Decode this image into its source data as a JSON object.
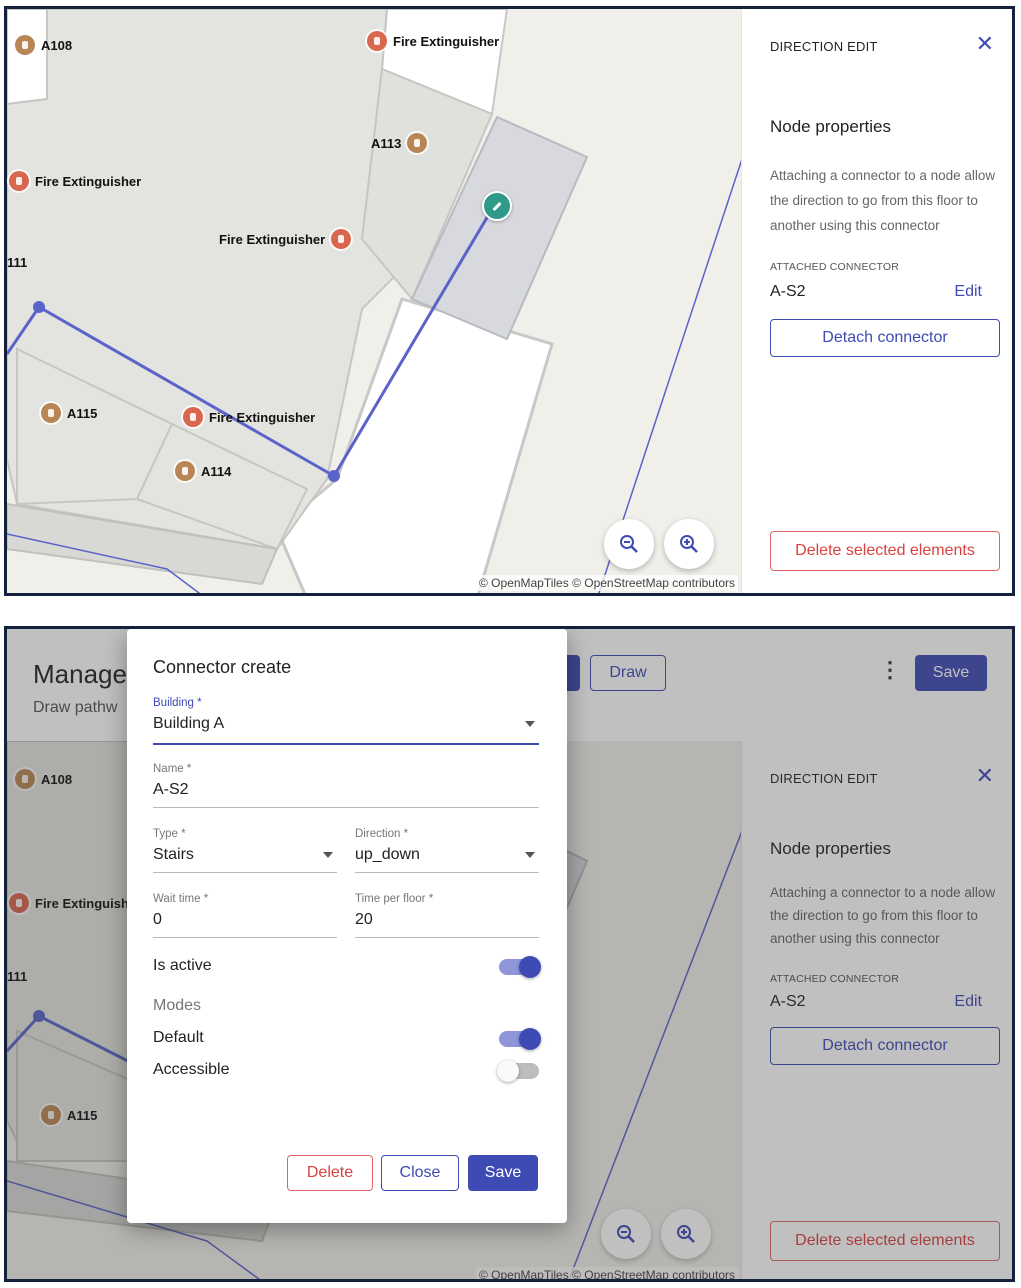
{
  "top_view": {
    "map": {
      "pois": [
        {
          "label": "A108",
          "kind": "room"
        },
        {
          "label": "Fire Extinguisher",
          "kind": "extinguisher"
        },
        {
          "label": "A113",
          "kind": "room"
        },
        {
          "label": "Fire Extinguisher",
          "kind": "extinguisher"
        },
        {
          "label": "Fire Extinguisher",
          "kind": "extinguisher"
        },
        {
          "label": "111",
          "kind": "room"
        },
        {
          "label": "A115",
          "kind": "room"
        },
        {
          "label": "Fire Extinguisher",
          "kind": "extinguisher"
        },
        {
          "label": "A114",
          "kind": "room"
        }
      ],
      "attribution": "© OpenMapTiles © OpenStreetMap contributors"
    },
    "panel": {
      "header": "DIRECTION EDIT",
      "node_title": "Node properties",
      "description": "Attaching a connector to a node allow the direction to go from this floor to another using this connector",
      "attached_label": "ATTACHED CONNECTOR",
      "attached_value": "A-S2",
      "edit_label": "Edit",
      "detach_label": "Detach connector",
      "delete_label": "Delete selected elements"
    }
  },
  "bottom_view": {
    "header": {
      "title_fragment": "Manage",
      "subtitle_fragment": "Draw pathw",
      "draw_label": "Draw",
      "save_label": "Save"
    },
    "map": {
      "pois": [
        {
          "label": "A108",
          "kind": "room"
        },
        {
          "label": "Fire Extinguish",
          "kind": "extinguisher"
        },
        {
          "label": "111",
          "kind": "room"
        },
        {
          "label": "A115",
          "kind": "room"
        }
      ],
      "attribution": "© OpenMapTiles © OpenStreetMap contributors"
    },
    "panel": {
      "header": "DIRECTION EDIT",
      "node_title": "Node properties",
      "description": "Attaching a connector to a node allow the direction to go from this floor to another using this connector",
      "attached_label": "ATTACHED CONNECTOR",
      "attached_value": "A-S2",
      "edit_label": "Edit",
      "detach_label": "Detach connector",
      "delete_label": "Delete selected elements"
    },
    "dialog": {
      "title": "Connector create",
      "building": {
        "label": "Building *",
        "value": "Building A"
      },
      "name": {
        "label": "Name *",
        "value": "A-S2"
      },
      "type": {
        "label": "Type *",
        "value": "Stairs"
      },
      "direction": {
        "label": "Direction *",
        "value": "up_down"
      },
      "wait_time": {
        "label": "Wait time *",
        "value": "0"
      },
      "time_per_floor": {
        "label": "Time per floor *",
        "value": "20"
      },
      "is_active": {
        "label": "Is active",
        "on": true
      },
      "modes_label": "Modes",
      "default_mode": {
        "label": "Default",
        "on": true
      },
      "accessible_mode": {
        "label": "Accessible",
        "on": false
      },
      "delete_label": "Delete",
      "close_label": "Close",
      "save_label": "Save"
    }
  },
  "colors": {
    "accent": "#3f4bb5",
    "danger": "#d9423f",
    "room_poi": "#b88654",
    "extinguisher_poi": "#d9664f",
    "node_pin": "#2f9a8a"
  }
}
